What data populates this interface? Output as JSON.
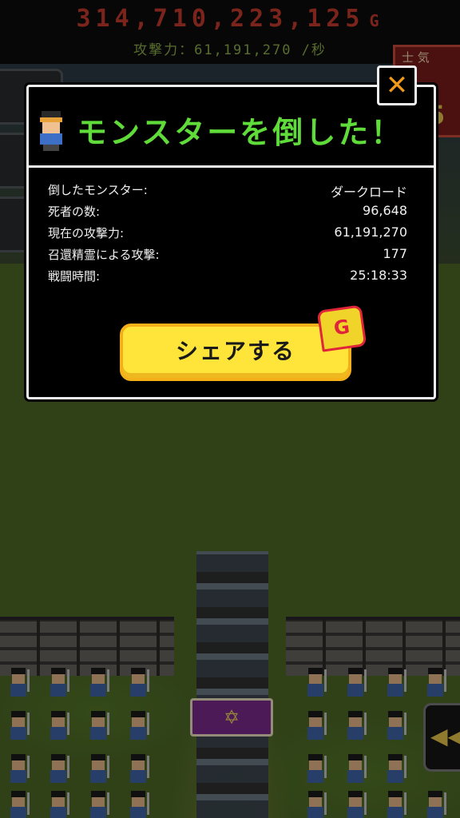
{
  "hud": {
    "gold": "314,710,223,125",
    "gold_unit": "G",
    "attack": "攻撃力：61,191,270 /秒",
    "morale_label": "士 気",
    "morale_value": "5"
  },
  "dialog": {
    "title": "モンスターを倒した！",
    "close_label": "✕",
    "stats": [
      {
        "label": "倒したモンスター:",
        "value": "ダークロード"
      },
      {
        "label": "死者の数:",
        "value": "96,648"
      },
      {
        "label": "現在の攻撃力:",
        "value": "61,191,270"
      },
      {
        "label": "召還精霊による攻撃:",
        "value": "177"
      },
      {
        "label": "戦闘時間:",
        "value": "25:18:33"
      }
    ],
    "share_label": "シェアする",
    "badge_label": "G"
  },
  "colors": {
    "title_green": "#5fdc3a",
    "share_yellow": "#ffe43a",
    "close_orange": "#f09a1a",
    "gold_red": "#c63a2d"
  }
}
